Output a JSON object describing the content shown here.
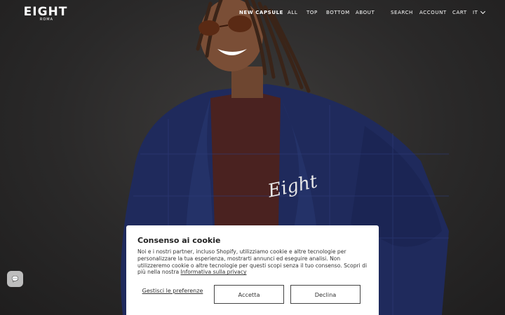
{
  "brand": {
    "name": "EIGHT",
    "sub": "ROMA"
  },
  "nav": {
    "primary": [
      "NEW CAPSULE",
      "ALL",
      "TOP",
      "BOTTOM",
      "ABOUT"
    ],
    "utility": [
      "SEARCH",
      "ACCOUNT",
      "CART"
    ],
    "language": "IT"
  },
  "chat": {
    "icon": "chat-bubble-icon",
    "glyph": "💬"
  },
  "cookie": {
    "title": "Consenso ai cookie",
    "body": "Noi e i nostri partner, incluso Shopify, utilizziamo cookie e altre tecnologie per personalizzare la tua esperienza, mostrarti annunci ed eseguire analisi. Non utilizzeremo cookie o altre tecnologie per questi scopi senza il tuo consenso. Scopri di più nella nostra ",
    "privacy_link": "Informativa sulla privacy",
    "manage": "Gestisci le preferenze",
    "accept": "Accetta",
    "decline": "Declina"
  },
  "colors": {
    "background": "#2c2b2b",
    "jacket": "#1f2a5c",
    "shirt": "#4a2220",
    "banner": "#ffffff"
  }
}
